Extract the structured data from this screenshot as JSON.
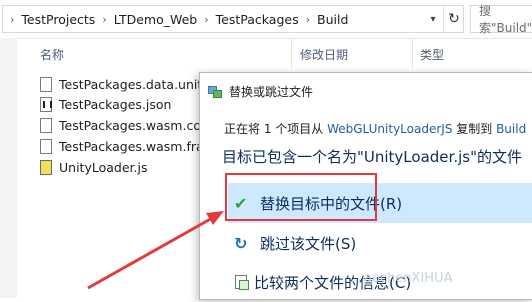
{
  "breadcrumb": [
    "TestProjects",
    "LTDemo_Web",
    "TestPackages",
    "Build"
  ],
  "search": {
    "placeholder": "搜索\"Build\""
  },
  "columns": {
    "name": "名称",
    "modified": "修改日期",
    "type": "类型"
  },
  "files": [
    {
      "name": "TestPackages.data.unityweb",
      "icon": "file-icon"
    },
    {
      "name": "TestPackages.json",
      "icon": "json-file-icon"
    },
    {
      "name": "TestPackages.wasm.code.unityweb",
      "icon": "file-icon"
    },
    {
      "name": "TestPackages.wasm.framework.unityweb",
      "icon": "file-icon"
    },
    {
      "name": "UnityLoader.js",
      "icon": "js-file-icon"
    }
  ],
  "dialog": {
    "title": "替换或跳过文件",
    "progress_prefix": "正在将 1 个项目从 ",
    "source": "WebGLUnityLoaderJS",
    "progress_mid": " 复制到 ",
    "dest": "Build",
    "message": "目标已包含一个名为\"UnityLoader.js\"的文件",
    "options": [
      {
        "label": "替换目标中的文件(R)",
        "icon": "checkmark-icon"
      },
      {
        "label": "跳过该文件(S)",
        "icon": "skip-icon"
      },
      {
        "label": "比较两个文件的信息(C)",
        "icon": "compare-icon"
      }
    ]
  },
  "watermark": "aochenXIHUA",
  "colors": {
    "highlight_border": "#e23b3b",
    "selected_option_bg": "#cde8ff",
    "link": "#1f5ca8"
  }
}
